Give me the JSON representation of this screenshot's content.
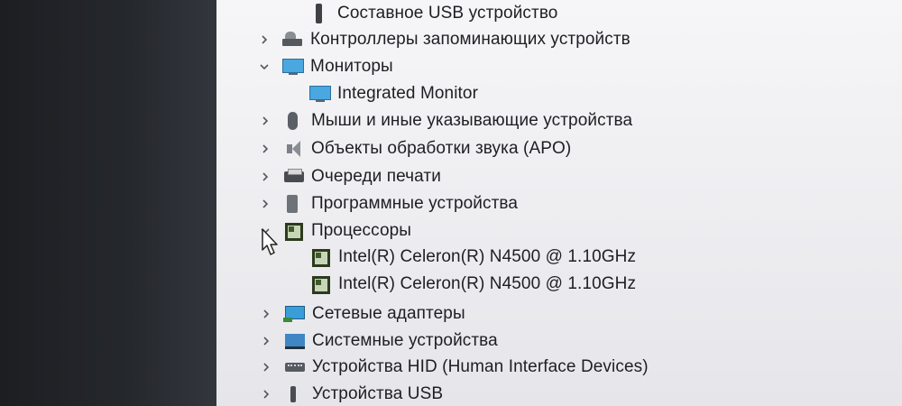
{
  "tree": {
    "items": [
      {
        "label": "Составное USB устройство",
        "icon": "usb-composite-icon",
        "expander": "none"
      },
      {
        "label": "Контроллеры запоминающих устройств",
        "icon": "storage-controller-icon",
        "expander": "collapsed"
      },
      {
        "label": "Мониторы",
        "icon": "monitor-icon",
        "expander": "expanded"
      },
      {
        "label": "Integrated Monitor",
        "icon": "monitor-icon",
        "expander": "none"
      },
      {
        "label": "Мыши и иные указывающие устройства",
        "icon": "mouse-icon",
        "expander": "collapsed"
      },
      {
        "label": "Объекты обработки звука (APO)",
        "icon": "speaker-icon",
        "expander": "collapsed"
      },
      {
        "label": "Очереди печати",
        "icon": "printer-icon",
        "expander": "collapsed"
      },
      {
        "label": "Программные устройства",
        "icon": "chip-icon",
        "expander": "collapsed"
      },
      {
        "label": "Процессоры",
        "icon": "processor-icon",
        "expander": "expanded"
      },
      {
        "label": "Intel(R) Celeron(R) N4500 @ 1.10GHz",
        "icon": "processor-icon",
        "expander": "none"
      },
      {
        "label": "Intel(R) Celeron(R) N4500 @ 1.10GHz",
        "icon": "processor-icon",
        "expander": "none"
      },
      {
        "label": "Сетевые адаптеры",
        "icon": "network-adapter-icon",
        "expander": "collapsed"
      },
      {
        "label": "Системные устройства",
        "icon": "system-device-icon",
        "expander": "collapsed"
      },
      {
        "label": "Устройства HID (Human Interface Devices)",
        "icon": "hid-icon",
        "expander": "collapsed"
      },
      {
        "label": "Устройства USB",
        "icon": "usb-icon",
        "expander": "collapsed"
      }
    ]
  },
  "colors": {
    "text": "#1e1f22",
    "background": "#f0f0f3",
    "monitor_blue": "#4aa7df"
  }
}
